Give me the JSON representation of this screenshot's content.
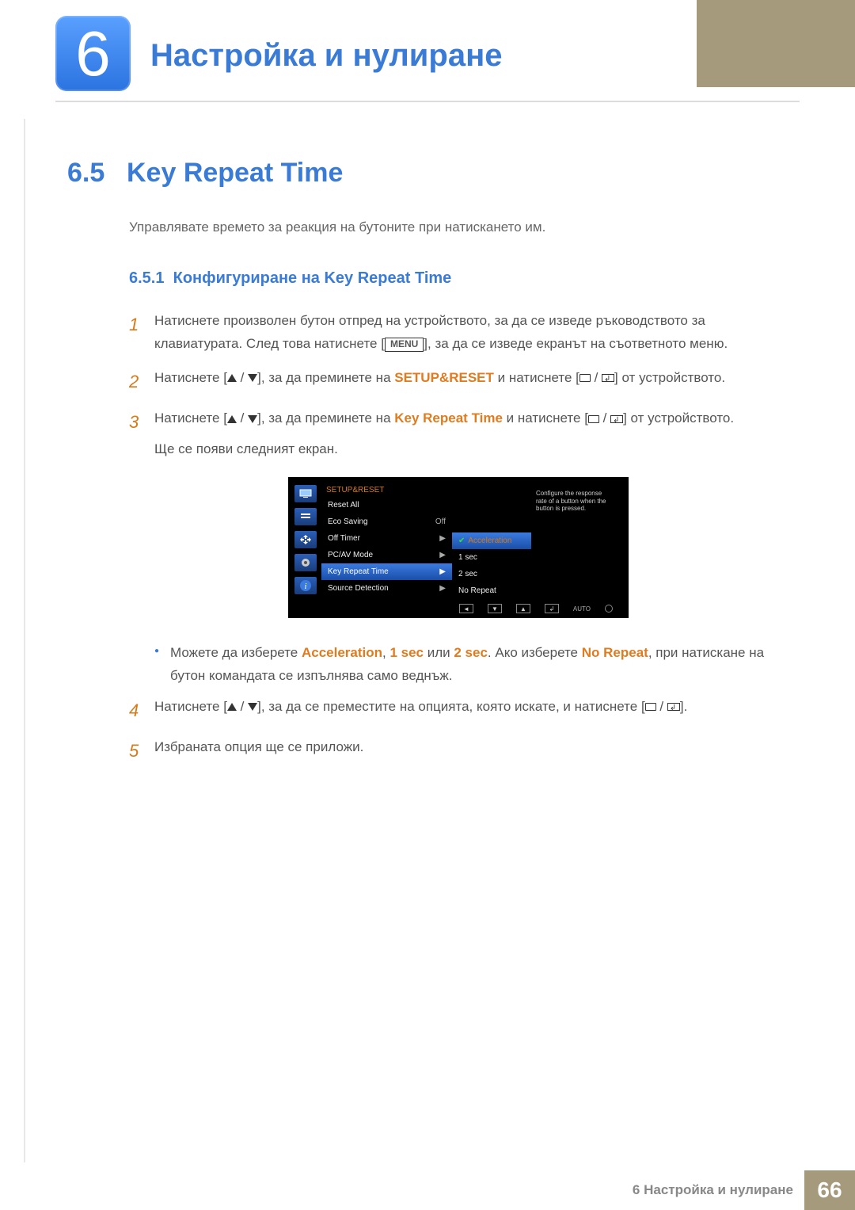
{
  "chapter": {
    "number": "6",
    "title": "Настройка и нулиране"
  },
  "section": {
    "number": "6.5",
    "title": "Key Repeat Time",
    "intro": "Управлявате времето за реакция на бутоните при натискането им."
  },
  "subsection": {
    "number": "6.5.1",
    "title": "Конфигуриране на Key Repeat Time"
  },
  "steps": {
    "s1": {
      "n": "1",
      "a": "Натиснете произволен бутон отпред на устройството, за да се изведе ръководството за клавиатурата. След това натиснете [",
      "menu": "MENU",
      "b": "], за да се изведе екранът на съответното меню."
    },
    "s2": {
      "n": "2",
      "a": "Натиснете [",
      "b": "], за да преминете на ",
      "target": "SETUP&RESET",
      "c": " и натиснете [",
      "d": "] от устройството."
    },
    "s3": {
      "n": "3",
      "a": "Натиснете [",
      "b": "], за да преминете на ",
      "target": "Key Repeat Time",
      "c": " и натиснете [",
      "d": "] от устройството.",
      "e": "Ще се появи следният екран."
    },
    "s4": {
      "n": "4",
      "a": "Натиснете [",
      "b": "], за да се преместите на опцията, която искате, и натиснете [",
      "c": "]."
    },
    "s5": {
      "n": "5",
      "a": "Избраната опция ще се приложи."
    }
  },
  "bullet": {
    "a": "Можете да изберете ",
    "opt1": "Acceleration",
    "sep1": ", ",
    "opt2": "1 sec",
    "sep2": " или ",
    "opt3": "2 sec",
    "b": ". Ако изберете ",
    "opt4": "No Repeat",
    "c": ", при натискане на бутон командата се изпълнява само веднъж."
  },
  "osd": {
    "title": "SETUP&RESET",
    "items": {
      "i0": "Reset All",
      "i1": "Eco Saving",
      "i1v": "Off",
      "i2": "Off Timer",
      "i3": "PC/AV Mode",
      "i4": "Key Repeat Time",
      "i5": "Source Detection"
    },
    "sub": {
      "s0": "Acceleration",
      "s1": "1 sec",
      "s2": "2 sec",
      "s3": "No Repeat"
    },
    "desc": "Configure the response rate of a button when the button is pressed.",
    "auto": "AUTO"
  },
  "footer": {
    "text": "6 Настройка и нулиране",
    "page": "66"
  }
}
